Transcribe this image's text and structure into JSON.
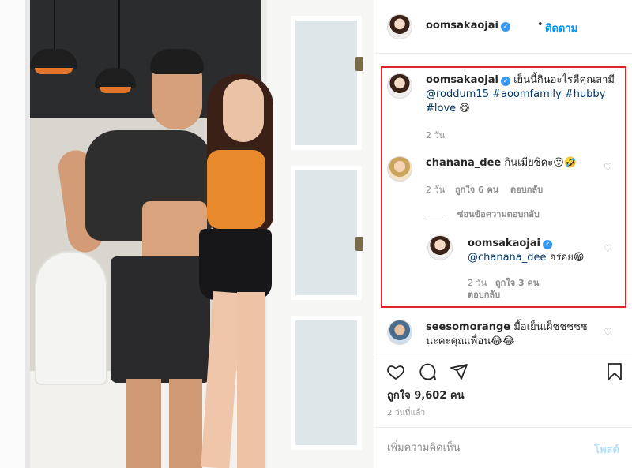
{
  "post": {
    "username": "oomsakaojai",
    "dot": "•",
    "follow_label": "ติดตาม"
  },
  "caption": {
    "username": "oomsakaojai",
    "text": "เย็นนี้กินอะไรดีคุณสามี",
    "mention": "@roddum15",
    "tags": [
      "#aoomfamily",
      "#hubby",
      "#love"
    ],
    "emoji": "😋",
    "time": "2 วัน"
  },
  "comments": [
    {
      "username": "chanana_dee",
      "text": "กินเมียซิคะ😛🤣",
      "time": "2 วัน",
      "likes": "ถูกใจ 6 คน",
      "reply_label": "ตอบกลับ",
      "toggle_replies": "ซ่อนข้อความตอบกลับ"
    },
    {
      "username": "seesomorange",
      "text": "มื้อเย็นเผ็ชชชชช นะคะคุณเพื่อน😂😂"
    }
  ],
  "reply": {
    "username": "oomsakaojai",
    "mention": "@chanana_dee",
    "text": "อร่อย😁",
    "time": "2 วัน",
    "likes": "ถูกใจ 3 คน",
    "reply_label": "ตอบกลับ"
  },
  "stats": {
    "likes": "ถูกใจ 9,602 คน",
    "time_ago": "2 วันที่แล้ว"
  },
  "add_comment": {
    "placeholder": "เพิ่มความคิดเห็น",
    "post_label": "โพสต์"
  },
  "icons": {
    "heart": "heart-icon",
    "comment": "comment-icon",
    "share": "share-icon",
    "bookmark": "bookmark-icon",
    "verified": "verified-badge-icon"
  },
  "colors": {
    "link_blue": "#0095f6",
    "hashtag": "#00376b",
    "highlight": "#e0242a",
    "muted": "#8e8e8e"
  }
}
